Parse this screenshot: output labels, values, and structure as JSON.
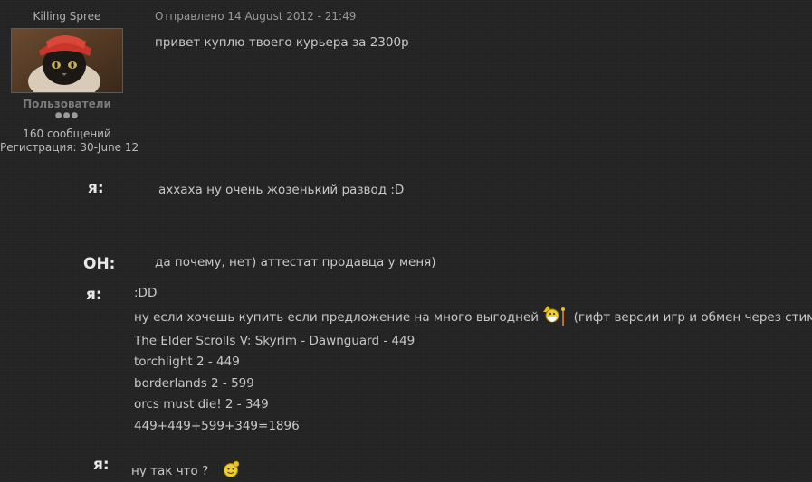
{
  "profile": {
    "username": "Killing Spree",
    "group": "Пользователи",
    "rank_pips": "●●●",
    "post_count": "160 сообщений",
    "registration": "Регистрация: 30-June 12"
  },
  "post": {
    "posted_label": "Отправлено 14 August 2012 - 21:49",
    "first_message": "привет куплю твоего курьера за 2300р"
  },
  "dialog": [
    {
      "speaker": "я:",
      "text": "аххаха ну очень жозенький развод :D"
    },
    {
      "speaker": "ОН:",
      "text": "да почему, нет) аттестат продавца у меня)"
    },
    {
      "speaker": "я:",
      "line1": ":DD",
      "line2_a": "ну если хочешь купить если предложение на много выгодней",
      "line2_b": "(гифт версии игр и обмен через стим",
      "line2_c": ")",
      "items": [
        "The Elder Scrolls V: Skyrim - Dawnguard - 449",
        "torchlight 2 - 449",
        "borderlands 2 - 599",
        "orcs must die! 2 - 349",
        "449+449+599+349=1896"
      ]
    },
    {
      "speaker": "я:",
      "text": "ну так что ?"
    }
  ]
}
